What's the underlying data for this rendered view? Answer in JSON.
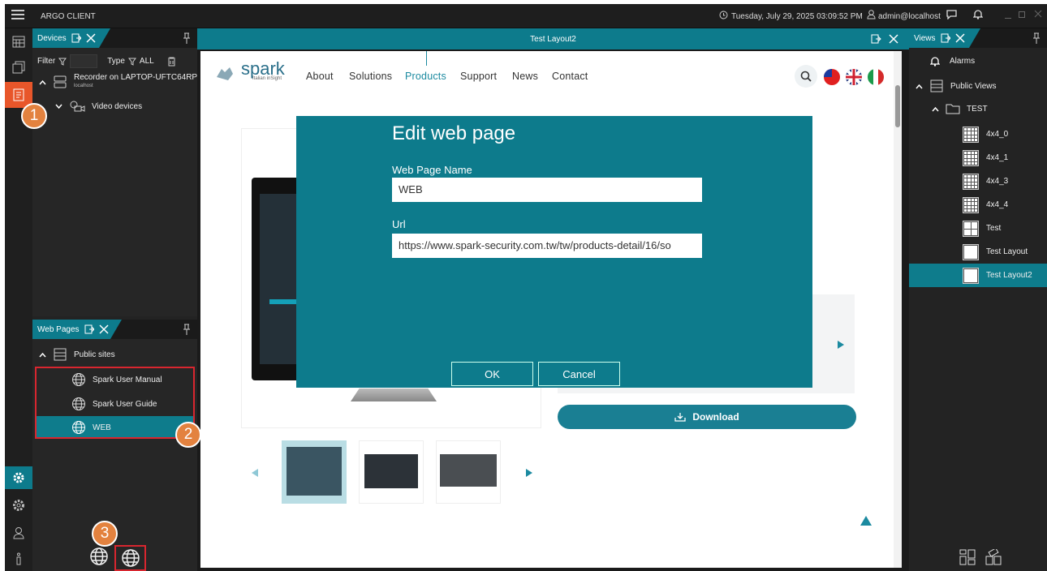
{
  "app": {
    "title": "ARGO CLIENT",
    "datetime": "Tuesday, July 29, 2025 03:09:52 PM",
    "user": "admin@localhost"
  },
  "devices_panel": {
    "tab_label": "Devices",
    "filter_label": "Filter",
    "type_label": "Type",
    "type_value": "ALL",
    "recorder_name": "Recorder on LAPTOP-UFTC64RP",
    "recorder_host": "localhost",
    "video_devices": "Video devices"
  },
  "webpages_panel": {
    "tab_label": "Web Pages",
    "group": "Public sites",
    "items": [
      {
        "label": "Spark User Manual"
      },
      {
        "label": "Spark User Guide"
      },
      {
        "label": "WEB"
      }
    ]
  },
  "center": {
    "title": "Test Layout2",
    "site": {
      "logo_text": "spark",
      "logo_tagline": "Italian inSight",
      "nav": [
        "About",
        "Solutions",
        "Products",
        "Support",
        "News",
        "Contact"
      ],
      "active_nav": "Products",
      "download_label": "Download"
    },
    "modal": {
      "title": "Edit web page",
      "name_label": "Web Page Name",
      "name_value": "WEB",
      "url_label": "Url",
      "url_value": "https://www.spark-security.com.tw/tw/products-detail/16/so",
      "ok_label": "OK",
      "cancel_label": "Cancel"
    }
  },
  "views_panel": {
    "tab_label": "Views",
    "alarms": "Alarms",
    "public_views": "Public Views",
    "folder": "TEST",
    "layouts": [
      {
        "label": "4x4_0",
        "grid": 4
      },
      {
        "label": "4x4_1",
        "grid": 4
      },
      {
        "label": "4x4_3",
        "grid": 4
      },
      {
        "label": "4x4_4",
        "grid": 4
      },
      {
        "label": "Test",
        "grid": 2
      },
      {
        "label": "Test Layout",
        "grid": 1
      },
      {
        "label": "Test Layout2",
        "grid": 1
      }
    ],
    "selected": "Test Layout2"
  },
  "annotations": [
    "1",
    "2",
    "3"
  ],
  "colors": {
    "accent": "#0d7b8c",
    "badge": "#e3823f",
    "highlight_box": "#d8262f",
    "active_rail": "#e8562a"
  }
}
